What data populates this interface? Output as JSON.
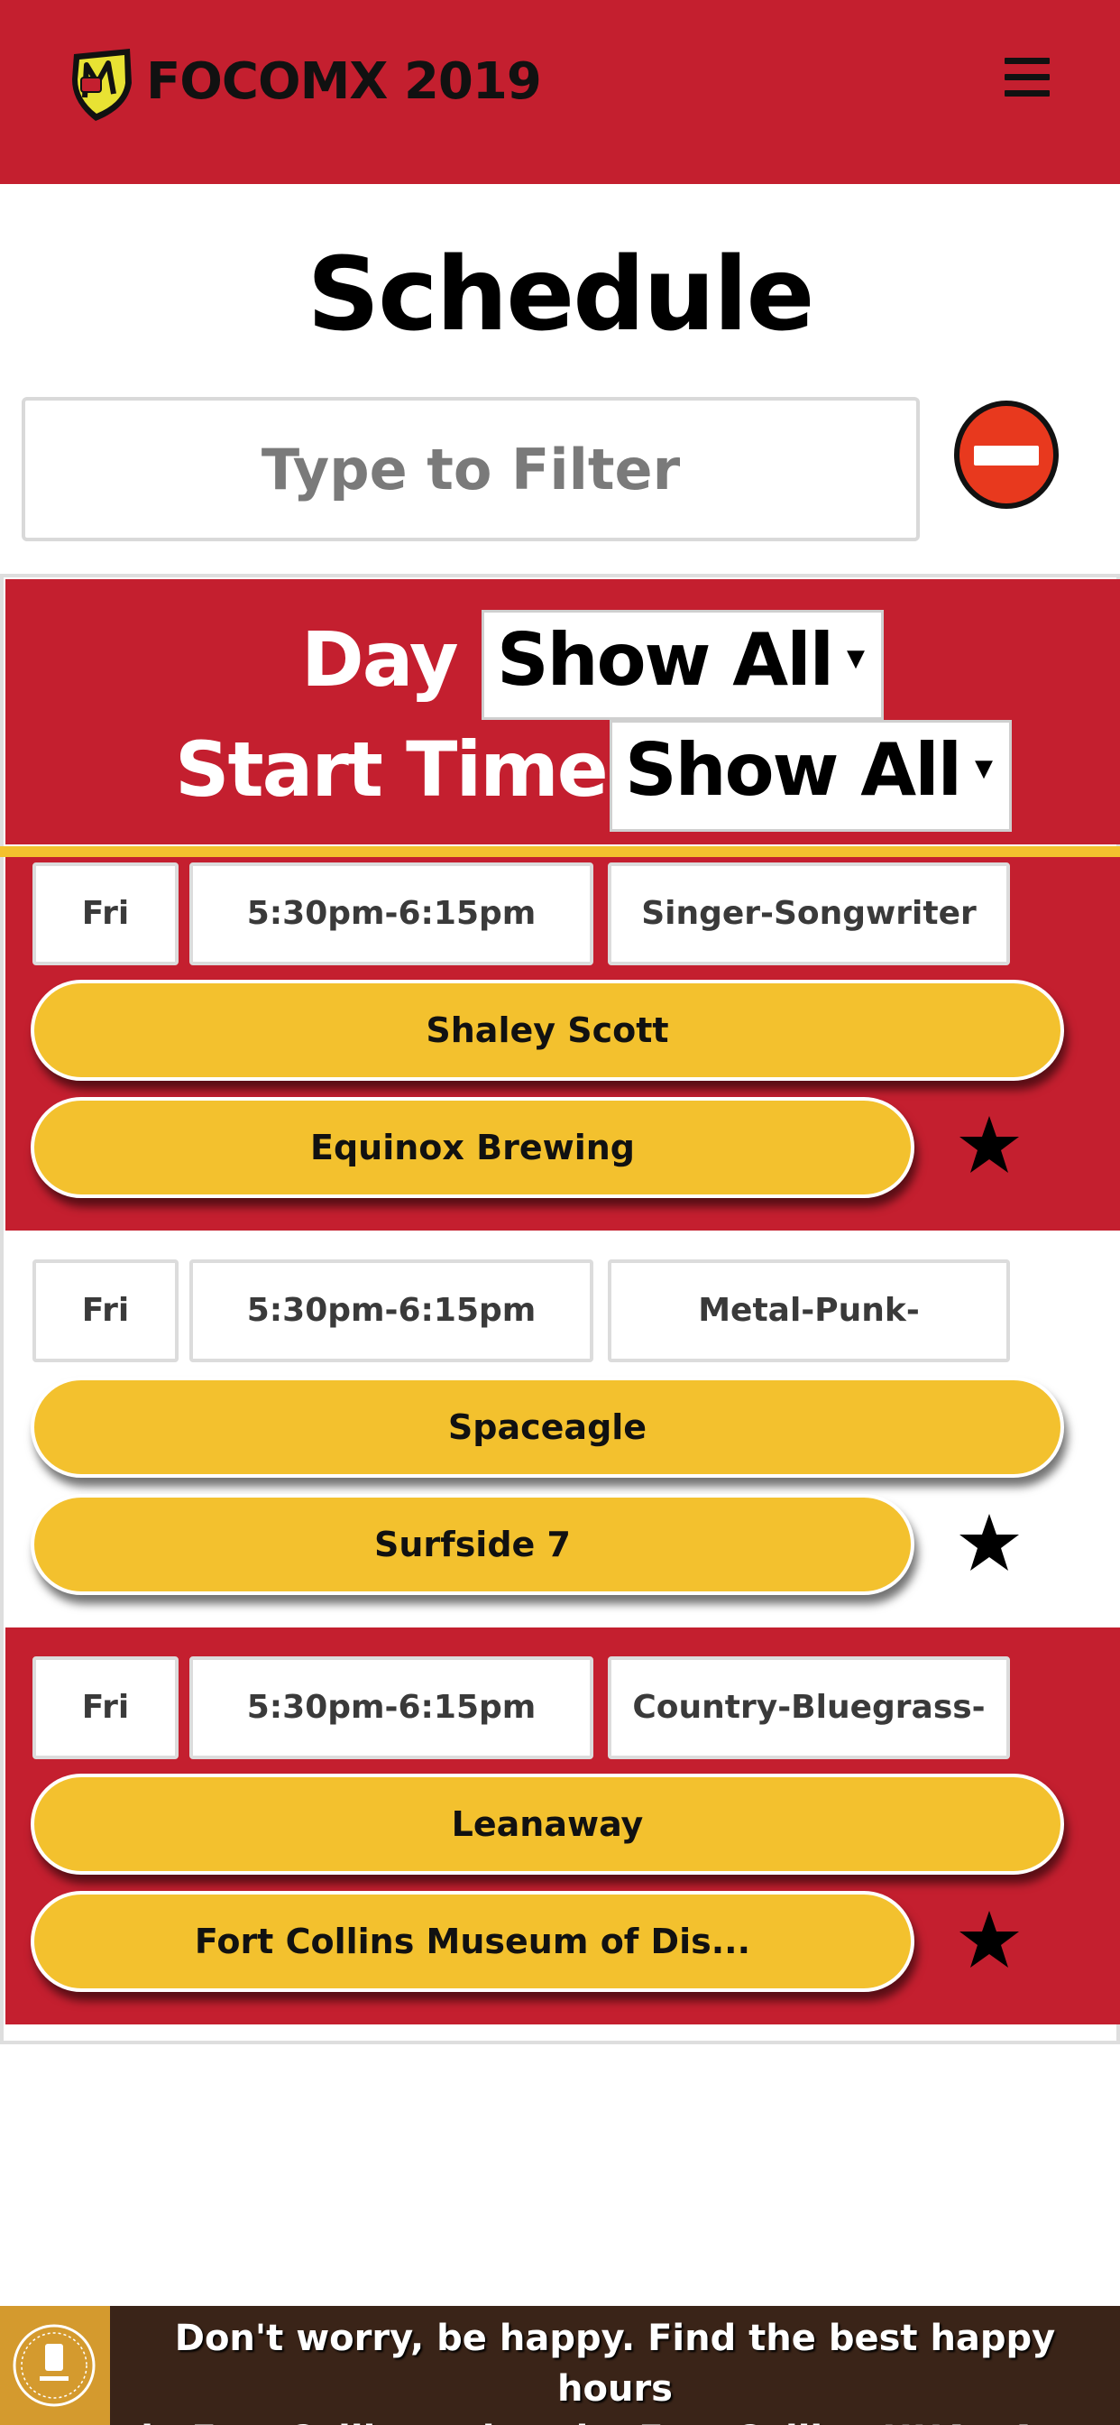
{
  "header": {
    "title": "FOCOMX 2019",
    "logo_icon": "focomx-shield-logo-icon",
    "menu_icon": "hamburger-menu-icon",
    "brand_color": "#c41f2f"
  },
  "page": {
    "title": "Schedule"
  },
  "search": {
    "placeholder": "Type to Filter",
    "value": "",
    "clear_icon": "minus-circle-icon",
    "clear_color": "#e8391e"
  },
  "filters": {
    "day_label": "Day",
    "day_value": "Show All",
    "start_label": "Start Time",
    "start_value": "Show All",
    "accent_color": "#f3c12e"
  },
  "events": [
    {
      "day": "Fri",
      "time": "5:30pm-6:15pm",
      "genre": "Singer-Songwriter",
      "artist": "Shaley Scott",
      "venue": "Equinox Brewing",
      "star_icon": "star-icon"
    },
    {
      "day": "Fri",
      "time": "5:30pm-6:15pm",
      "genre": "Metal-Punk-",
      "artist": "Spaceagle",
      "venue": "Surfside 7",
      "star_icon": "star-icon"
    },
    {
      "day": "Fri",
      "time": "5:30pm-6:15pm",
      "genre": "Country-Bluegrass-",
      "artist": "Leanaway",
      "venue": "Fort Collins Museum of Dis...",
      "star_icon": "star-icon"
    }
  ],
  "ad": {
    "line1": "Don't worry, be happy. Find the best happy hours",
    "line2": "in Fort Collins using the Fort Collins HHAP App",
    "logo_icon": "hhap-logo-icon"
  }
}
